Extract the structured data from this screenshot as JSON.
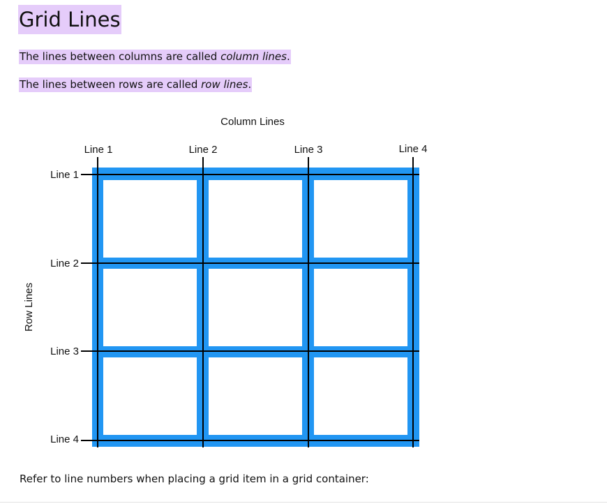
{
  "heading": "Grid Lines",
  "para1": {
    "prefix": "The lines between columns are called ",
    "emphasis": "column lines",
    "suffix": "."
  },
  "para2": {
    "prefix": "The lines between rows are called ",
    "emphasis": "row lines",
    "suffix": "."
  },
  "para3": "Refer to line numbers when placing a grid item in a grid container:",
  "diagram": {
    "column_title": "Column Lines",
    "row_title": "Row Lines",
    "column_lines": [
      "Line 1",
      "Line 2",
      "Line 3",
      "Line 4"
    ],
    "row_lines": [
      "Line 1",
      "Line 2",
      "Line 3",
      "Line 4"
    ],
    "colors": {
      "grid_fill": "#2196f3",
      "cell_fill": "#ffffff",
      "line": "#000000",
      "highlight": "#e5ccfa"
    }
  }
}
